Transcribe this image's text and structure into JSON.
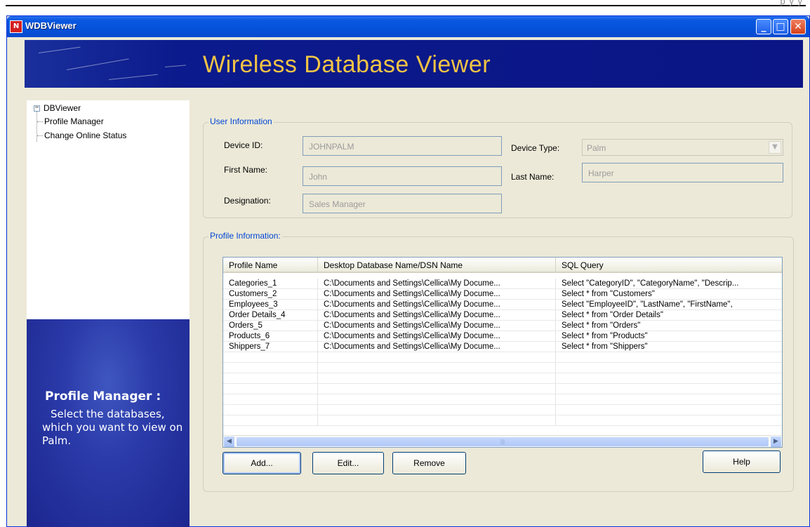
{
  "window": {
    "title": "WDBViewer",
    "app_icon_text": "N",
    "buttons": {
      "minimize": "_",
      "maximize": "□",
      "close": "✕"
    }
  },
  "top_strip_tail": "p  y  y",
  "banner": {
    "title": "Wireless Database Viewer"
  },
  "tree": {
    "root": "DBViewer",
    "expander": "−",
    "children": [
      "Profile Manager",
      "Change Online Status"
    ]
  },
  "info_panel": {
    "title": "Profile Manager :",
    "body": "Select the databases, which you want to view on Palm."
  },
  "user_info": {
    "legend": "User Information",
    "device_id_label": "Device ID:",
    "device_id_value": "JOHNPALM",
    "device_type_label": "Device Type:",
    "device_type_value": "Palm",
    "first_name_label": "First Name:",
    "first_name_value": "John",
    "last_name_label": "Last Name:",
    "last_name_value": "Harper",
    "designation_label": "Designation:",
    "designation_value": "Sales Manager"
  },
  "profile_info": {
    "legend": "Profile Information:",
    "columns": [
      "Profile Name",
      "Desktop Database Name/DSN Name",
      "SQL Query"
    ],
    "rows": [
      [
        "Categories_1",
        "C:\\Documents and Settings\\Cellica\\My Docume...",
        "Select \"CategoryID\", \"CategoryName\", \"Descrip..."
      ],
      [
        "Customers_2",
        "C:\\Documents and Settings\\Cellica\\My Docume...",
        "Select * from \"Customers\""
      ],
      [
        "Employees_3",
        "C:\\Documents and Settings\\Cellica\\My Docume...",
        "Select \"EmployeeID\", \"LastName\", \"FirstName\","
      ],
      [
        "Order Details_4",
        "C:\\Documents and Settings\\Cellica\\My Docume...",
        "Select * from \"Order Details\""
      ],
      [
        "Orders_5",
        "C:\\Documents and Settings\\Cellica\\My Docume...",
        "Select * from \"Orders\""
      ],
      [
        "Products_6",
        "C:\\Documents and Settings\\Cellica\\My Docume...",
        "Select * from \"Products\""
      ],
      [
        "Shippers_7",
        "C:\\Documents and Settings\\Cellica\\My Docume...",
        "Select * from \"Shippers\""
      ]
    ],
    "scroll_left": "◀",
    "scroll_right": "▶",
    "scroll_grip": "|||"
  },
  "actions": {
    "add": "Add...",
    "edit": "Edit...",
    "remove": "Remove",
    "help": "Help"
  }
}
